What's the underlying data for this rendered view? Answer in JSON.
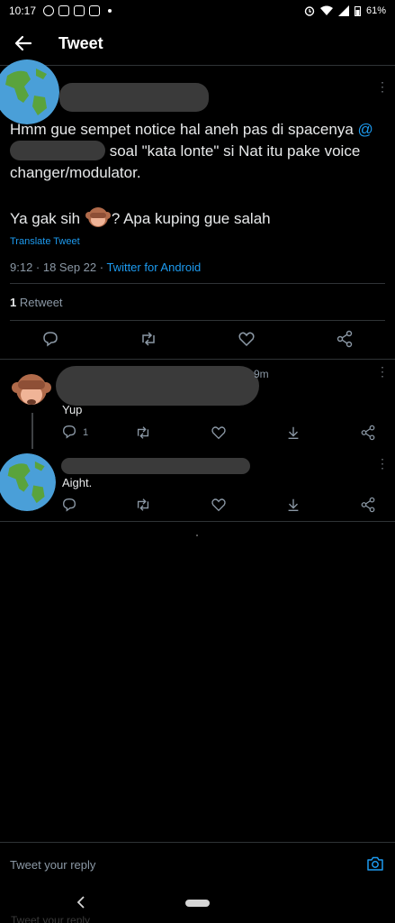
{
  "status_bar": {
    "time": "10:17",
    "battery": "61%"
  },
  "header": {
    "title": "Tweet"
  },
  "main_tweet": {
    "text_before_mention": "Hmm gue sempet notice hal aneh pas di spacenya ",
    "mention_prefix": "@",
    "text_after_mention": " soal \"kata lonte\" si Nat itu pake voice changer/modulator.",
    "line2_before": "Ya gak sih ",
    "line2_after": "? Apa kuping gue salah",
    "translate": "Translate Tweet",
    "meta_time": "9:12 · 18 Sep 22 · ",
    "meta_source": "Twitter for Android",
    "retweet_count": "1",
    "retweet_label": " Retweet"
  },
  "replies": [
    {
      "time_fragment": "9m",
      "text": "Yup",
      "reply_count": "1"
    },
    {
      "text": "Aight."
    }
  ],
  "reply_bar": {
    "placeholder": "Tweet your reply",
    "ghost_text": "Tweet your reply"
  },
  "icons": [
    "back-arrow-icon",
    "reply-icon",
    "retweet-icon",
    "like-icon",
    "share-icon",
    "download-icon",
    "camera-icon",
    "more-icon",
    "globe-avatar",
    "monkey-emoji"
  ],
  "colors": {
    "background": "#000000",
    "accent": "#1d9bf0",
    "text": "#e7e9ea",
    "muted": "#8b98a5",
    "divider": "#2f3336"
  }
}
